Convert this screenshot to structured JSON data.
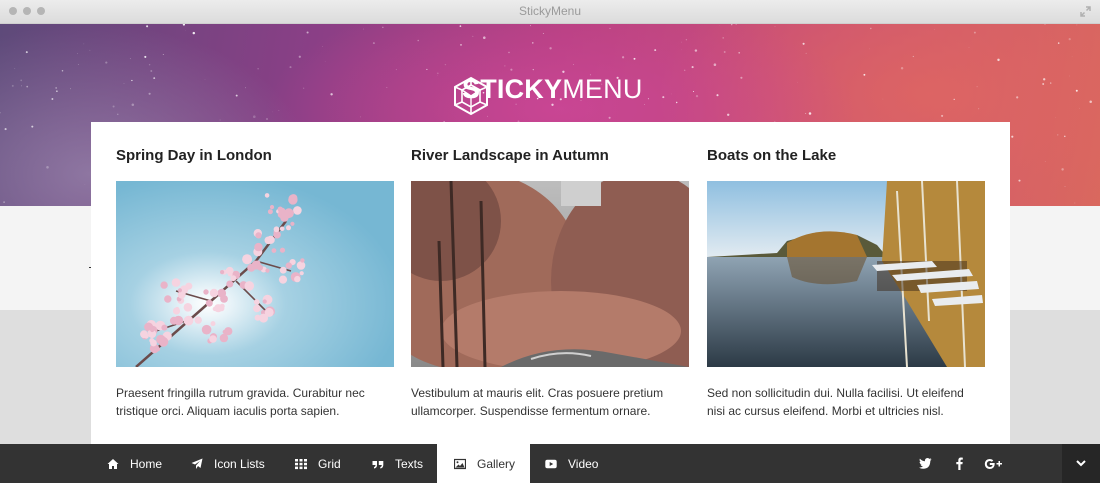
{
  "window": {
    "title": "StickyMenu"
  },
  "brand": {
    "name_bold": "STICKY",
    "name_light": "MENU"
  },
  "articles": [
    {
      "title": "Spring Day in London",
      "text": "Praesent fringilla rutrum gravida. Curabitur nec tristique orci. Aliquam iaculis porta sapien.",
      "image": "cherry-blossom-sky"
    },
    {
      "title": "River Landscape in Autumn",
      "text": "Vestibulum at mauris elit. Cras posuere pretium ullamcorper. Suspendisse fermentum ornare.",
      "image": "autumn-forest-river"
    },
    {
      "title": "Boats on the Lake",
      "text": "Sed non sollicitudin dui. Nulla facilisi. Ut eleifend nisi ac cursus eleifend. Morbi et ultricies nisl.",
      "image": "lake-boats"
    }
  ],
  "nav": {
    "items": [
      {
        "label": "Home",
        "icon": "home-icon"
      },
      {
        "label": "Icon Lists",
        "icon": "paper-plane-icon"
      },
      {
        "label": "Grid",
        "icon": "grid-icon"
      },
      {
        "label": "Texts",
        "icon": "quote-icon"
      },
      {
        "label": "Gallery",
        "icon": "image-icon",
        "active": true
      },
      {
        "label": "Video",
        "icon": "youtube-icon"
      }
    ],
    "social": [
      "twitter-icon",
      "facebook-icon",
      "google-plus-icon"
    ],
    "toggle_icon": "chevron-down-icon"
  },
  "colors": {
    "nav_bg": "#333333",
    "nav_active_bg": "#ffffff",
    "hero_accent": "#c4477f"
  }
}
